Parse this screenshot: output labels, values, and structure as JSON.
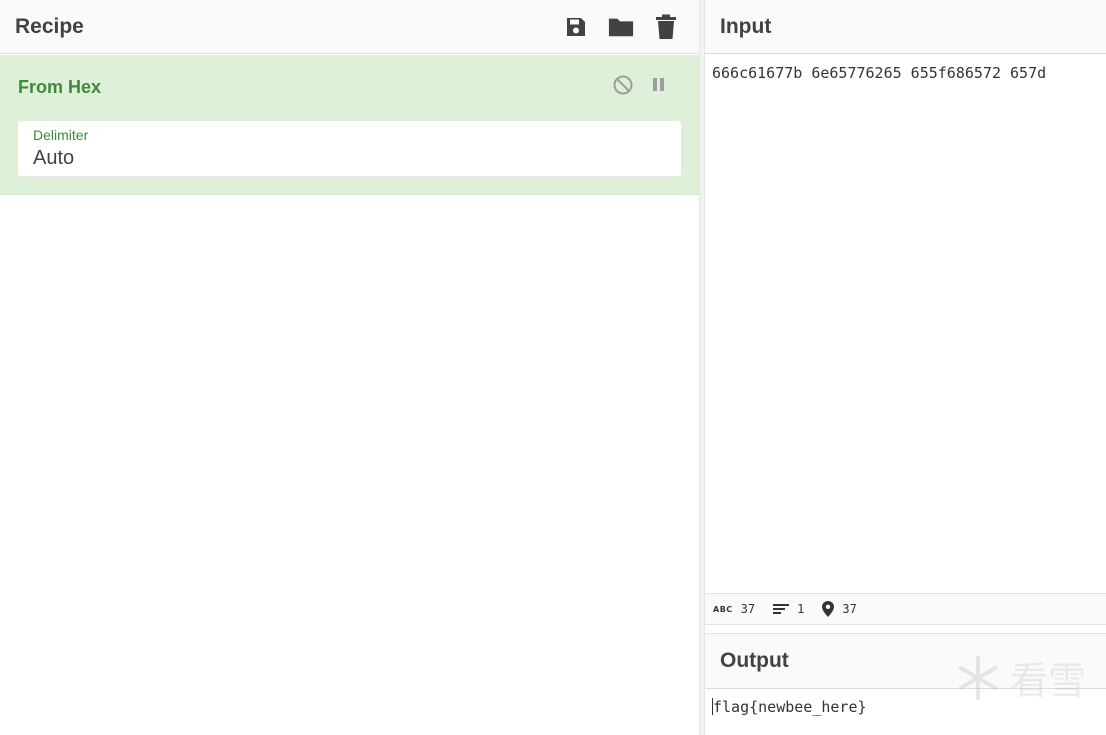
{
  "recipe": {
    "title": "Recipe",
    "icons": [
      "save-icon",
      "folder-icon",
      "trash-icon"
    ]
  },
  "operation": {
    "name": "From Hex",
    "controls": [
      "disable-icon",
      "pause-icon"
    ],
    "arg": {
      "label": "Delimiter",
      "value": "Auto"
    },
    "colors": {
      "background": "#dff0d8",
      "title": "#3c8a3c"
    }
  },
  "input": {
    "title": "Input",
    "text": "666c61677b 6e65776265 655f686572 657d"
  },
  "stats": {
    "length": "37",
    "lines": "1",
    "position": "37"
  },
  "output": {
    "title": "Output",
    "text": "flag{newbee_here}"
  },
  "watermark": {
    "text": "看雪",
    "icon": "snowflake-icon"
  }
}
